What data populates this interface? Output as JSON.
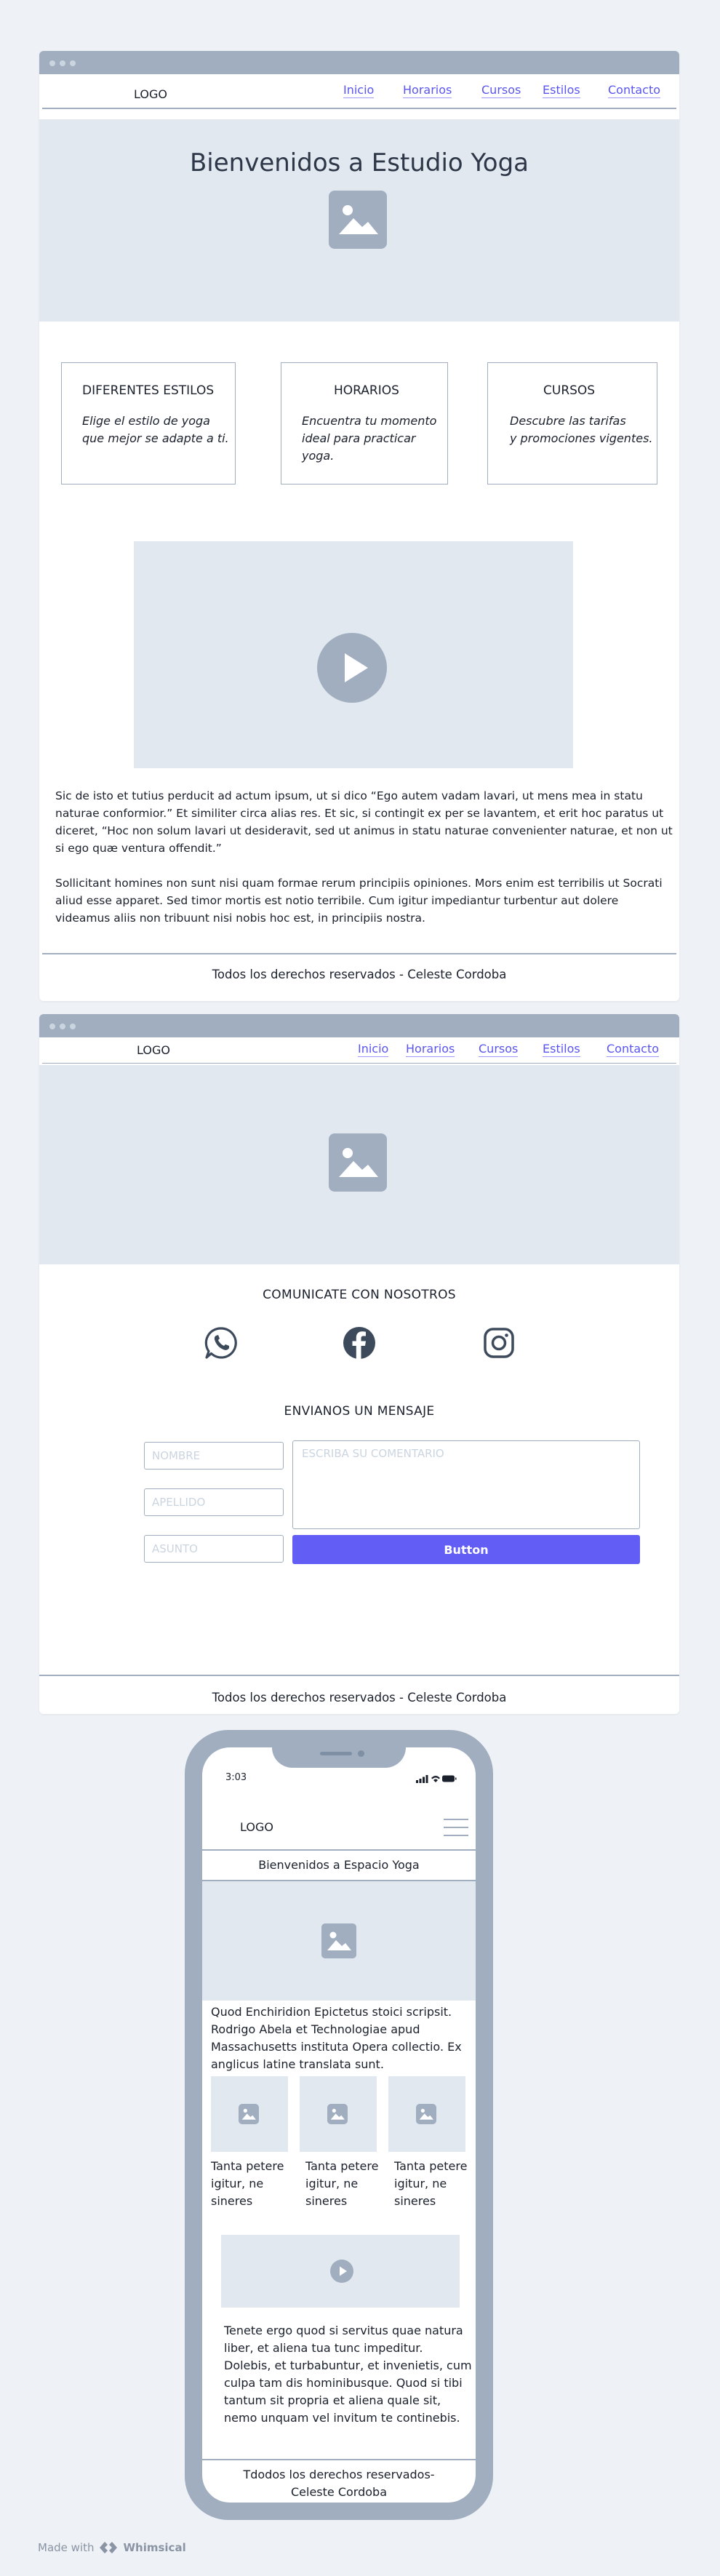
{
  "desktop1": {
    "nav": {
      "logo": "LOGO",
      "links": [
        "Inicio",
        "Horarios",
        "Cursos",
        "Estilos",
        "Contacto"
      ]
    },
    "hero_title": "Bienvenidos a Estudio Yoga",
    "cards": [
      {
        "title": "DIFERENTES ESTILOS",
        "lines": [
          "Elige el estilo de yoga",
          "que mejor se adapte a ti."
        ]
      },
      {
        "title": "HORARIOS",
        "lines": [
          "Encuentra tu momento",
          "ideal para practicar",
          "yoga."
        ]
      },
      {
        "title": "CURSOS",
        "lines": [
          "Descubre las tarifas",
          "y promociones vigentes."
        ]
      }
    ],
    "paragraphs": [
      [
        "Sic de isto et tutius perducit ad actum ipsum, ut si dico “Ego autem vadam lavari, ut mens mea in statu",
        "naturae conformior.” Et similiter circa alias res. Et sic, si contingit ex per se lavantem, et erit hoc paratus ut",
        "diceret, “Hoc non solum lavari ut desideravit, sed ut animus in statu naturae convenienter naturae, et non ut",
        "si ego quæ ventura offendit.”"
      ],
      [
        "Sollicitant homines non sunt nisi quam formae rerum principiis opiniones. Mors enim est terribilis ut Socrati",
        "aliud esse apparet. Sed timor mortis est notio terribile. Cum igitur impediantur turbentur aut dolere",
        "videamus aliis non tribuunt nisi nobis hoc est, in principiis nostra."
      ]
    ],
    "footer": "Todos los derechos reservados - Celeste Cordoba"
  },
  "desktop2": {
    "nav": {
      "logo": "LOGO",
      "links": [
        "Inicio",
        "Horarios",
        "Cursos",
        "Estilos",
        "Contacto"
      ]
    },
    "contact_title": "COMUNICATE CON NOSOTROS",
    "social_icons": [
      "whatsapp-icon",
      "facebook-icon",
      "instagram-icon"
    ],
    "message_title": "ENVIANOS UN MENSAJE",
    "form": {
      "name_placeholder": "NOMBRE",
      "lastname_placeholder": "APELLIDO",
      "subject_placeholder": "ASUNTO",
      "comment_placeholder": "ESCRIBA SU COMENTARIO",
      "button_label": "Button"
    },
    "footer": "Todos los derechos reservados - Celeste Cordoba"
  },
  "mobile": {
    "status_time": "3:03",
    "logo": "LOGO",
    "title": "Bienvenidos a Espacio Yoga",
    "intro_lines": [
      "Quod Enchiridion Epictetus stoici scripsit.",
      "Rodrigo Abela et Technologiae apud",
      "Massachusetts instituta Opera collectio. Ex",
      "anglicus latine translata sunt."
    ],
    "items": [
      [
        "Tanta petere",
        "igitur, ne",
        "sineres"
      ],
      [
        "Tanta petere",
        "igitur, ne",
        "sineres"
      ],
      [
        "Tanta petere",
        "igitur, ne",
        "sineres"
      ]
    ],
    "body_lines": [
      "Tenete ergo quod si servitus quae natura",
      "liber, et aliena tua tunc impeditur.",
      "Dolebis, et turbabuntur, et invenietis, cum",
      "culpa tam dis hominibusque. Quod si tibi",
      "tantum sit propria et aliena quale sit,",
      "nemo unquam vel invitum te continebis."
    ],
    "footer_lines": [
      "Tdodos los derechos reservados-",
      "Celeste Cordoba"
    ]
  },
  "watermark": {
    "prefix": "Made with",
    "brand": "Whimsical"
  },
  "colors": {
    "accent": "#625df5",
    "link": "#5a55f0",
    "placeholder_gray": "#a0aec0",
    "block_gray": "#e2e8f0",
    "page_bg": "#eef2f6"
  }
}
